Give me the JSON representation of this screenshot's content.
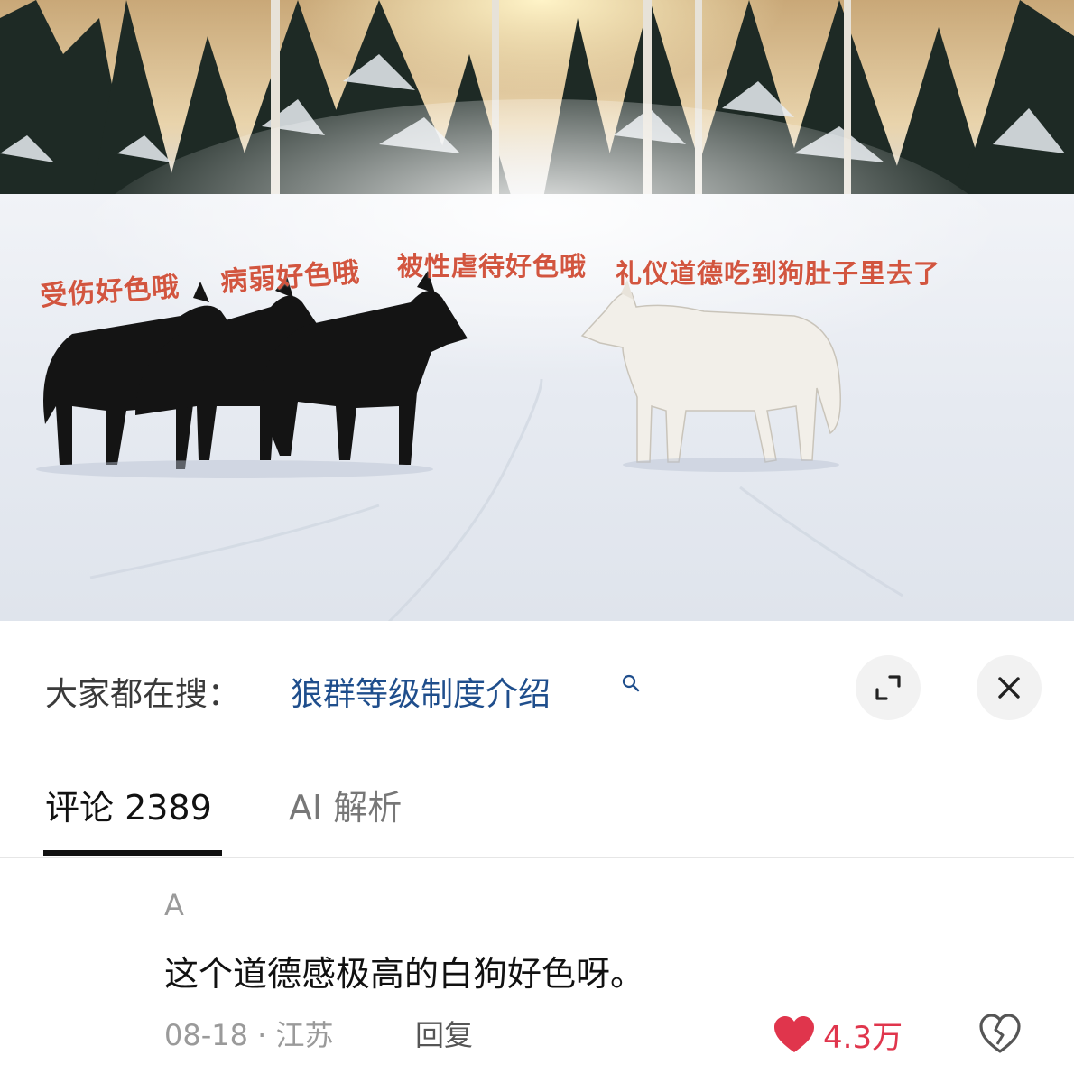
{
  "photo": {
    "captions": [
      "受伤好色哦",
      "病弱好色哦",
      "被性虐待好色哦",
      "礼仪道德吃到狗肚子里去了"
    ]
  },
  "search": {
    "prefix": "大家都在搜：",
    "query": "狼群等级制度介绍"
  },
  "tabs": {
    "comments_label": "评论 2389",
    "ai_label": "AI 解析"
  },
  "comment": {
    "author": "A",
    "text": "这个道德感极高的白狗好色呀。",
    "date_location": "08-18 · 江苏",
    "reply_label": "回复",
    "like_count": "4.3万"
  },
  "colors": {
    "caption": "#d2553f",
    "search_link": "#1f4e8c",
    "like": "#e0354c"
  },
  "icons": [
    "search-icon",
    "expand-icon",
    "close-icon",
    "heart-icon",
    "broken-heart-icon"
  ]
}
